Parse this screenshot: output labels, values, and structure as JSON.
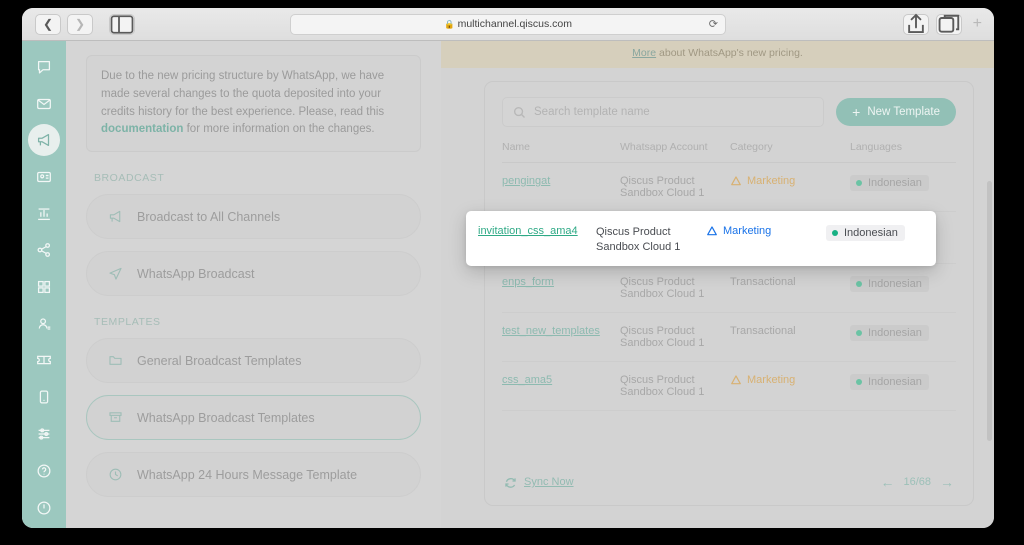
{
  "browser": {
    "url": "multichannel.qiscus.com",
    "back_icon": "chevron-left-icon",
    "forward_icon": "chevron-right-icon",
    "sidebar_icon": "sidebar-toggle-icon",
    "lock_icon": "lock-icon",
    "reload_icon": "reload-icon",
    "share_icon": "share-icon",
    "tabs_icon": "tab-overview-icon",
    "new_tab_label": "+"
  },
  "rail": {
    "items": [
      {
        "name": "chat-icon",
        "active": false
      },
      {
        "name": "inbox-icon",
        "active": false
      },
      {
        "name": "broadcast-icon",
        "active": true
      },
      {
        "name": "contact-card-icon",
        "active": false
      },
      {
        "name": "analytics-icon",
        "active": false
      },
      {
        "name": "integration-icon",
        "active": false
      },
      {
        "name": "apps-grid-icon",
        "active": false
      },
      {
        "name": "customer-icon",
        "active": false
      },
      {
        "name": "ticket-icon",
        "active": false
      },
      {
        "name": "mobile-icon",
        "active": false
      },
      {
        "name": "settings-sliders-icon",
        "active": false
      },
      {
        "name": "help-icon",
        "active": false
      },
      {
        "name": "power-icon",
        "active": false
      }
    ]
  },
  "notice": {
    "text_before": "Due to the new pricing structure by WhatsApp, we have made several changes to the quota deposited into your credits history for the best experience. Please, read this ",
    "link": "documentation",
    "text_after": " for more information on the changes."
  },
  "menu": {
    "sections": [
      {
        "title": "BROADCAST",
        "items": [
          {
            "label": "Broadcast to All Channels",
            "icon": "megaphone-icon",
            "active": false
          },
          {
            "label": "WhatsApp Broadcast",
            "icon": "paper-plane-icon",
            "active": false
          }
        ]
      },
      {
        "title": "TEMPLATES",
        "items": [
          {
            "label": "General Broadcast Templates",
            "icon": "folder-icon",
            "active": false
          },
          {
            "label": "WhatsApp Broadcast Templates",
            "icon": "archive-box-icon",
            "active": true
          },
          {
            "label": "WhatsApp 24 Hours Message Template",
            "icon": "clock-icon",
            "active": false
          }
        ]
      }
    ]
  },
  "pricing_banner": {
    "link": "More",
    "text": " about WhatsApp's new pricing."
  },
  "toolbar": {
    "search_placeholder": "Search template name",
    "search_value": "",
    "search_icon": "search-icon",
    "new_template_label": "New Template",
    "new_template_plus": "+"
  },
  "table": {
    "headers": [
      "Name",
      "Whatsapp Account",
      "Category",
      "Languages"
    ],
    "rows": [
      {
        "name": "pengingat",
        "account": "Qiscus Product Sandbox Cloud 1",
        "category": "Marketing",
        "category_type": "marketing",
        "language": "Indonesian"
      },
      {
        "name": "enps_form",
        "account": "Qiscus Product Sandbox Cloud 1",
        "category": "Transactional",
        "category_type": "transactional",
        "language": "Indonesian"
      },
      {
        "name": "test_new_templates",
        "account": "Qiscus Product Sandbox Cloud 1",
        "category": "Transactional",
        "category_type": "transactional",
        "language": "Indonesian"
      },
      {
        "name": "css_ama5",
        "account": "Qiscus Product Sandbox Cloud 1",
        "category": "Marketing",
        "category_type": "marketing",
        "language": "Indonesian"
      }
    ]
  },
  "spotlight_row": {
    "name": "invitation_css_ama4",
    "account_line1": "Qiscus Product",
    "account_line2": "Sandbox Cloud 1",
    "category": "Marketing",
    "warning_icon": "warning-triangle-icon",
    "language": "Indonesian"
  },
  "footer": {
    "sync_label": "Sync Now",
    "sync_icon": "refresh-icon",
    "prev_arrow": "←",
    "page_indicator": "16/68",
    "next_arrow": "→"
  },
  "colors": {
    "brand_teal": "#92c0b6",
    "rail_teal": "#9cc8bf",
    "link_green": "#2faa86",
    "marketing_orange": "#d8b172",
    "highlight_blue": "#1a73e8",
    "status_green": "#18b184",
    "banner_tan": "#d6cfbc"
  }
}
